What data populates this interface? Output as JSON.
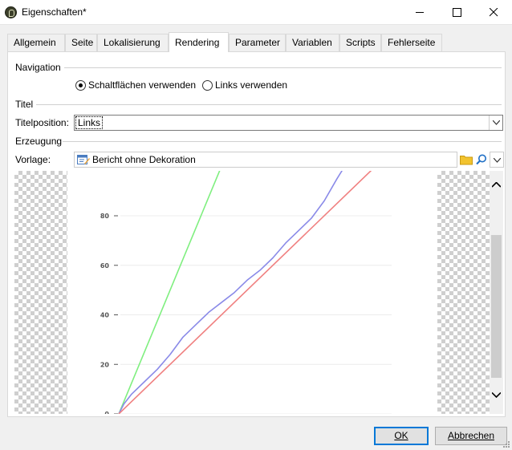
{
  "window": {
    "title": "Eigenschaften*"
  },
  "tabs": [
    {
      "label": "Allgemein"
    },
    {
      "label": "Seite"
    },
    {
      "label": "Lokalisierung"
    },
    {
      "label": "Rendering",
      "active": true
    },
    {
      "label": "Parameter"
    },
    {
      "label": "Variablen"
    },
    {
      "label": "Scripts"
    },
    {
      "label": "Fehlerseite"
    }
  ],
  "navigation": {
    "group_label": "Navigation",
    "option_buttons": "Schaltflächen verwenden",
    "option_links": "Links verwenden",
    "selected": "Schaltflächen verwenden"
  },
  "titel": {
    "group_label": "Titel",
    "position_label": "Titelposition:",
    "position_value": "Links"
  },
  "erzeugung": {
    "group_label": "Erzeugung",
    "vorlage_label": "Vorlage:",
    "vorlage_value": "Bericht ohne Dekoration"
  },
  "preview_chart": {
    "chart_data": {
      "type": "line",
      "title": "",
      "xlabel": "",
      "ylabel": "",
      "y_ticks": [
        0,
        20,
        40,
        60,
        80
      ],
      "ylim": [
        0,
        100
      ],
      "xlim": [
        0,
        100
      ],
      "grid": true,
      "series": [
        {
          "color": "#7fef7f",
          "x": [
            0,
            40
          ],
          "y": [
            0,
            100
          ]
        },
        {
          "color": "#8a8ae8",
          "x": [
            0,
            2,
            5,
            10,
            15,
            20,
            25,
            30,
            35,
            40,
            45,
            50,
            55,
            60,
            65,
            70,
            75,
            80,
            85,
            88
          ],
          "y": [
            0,
            4,
            8,
            13,
            18,
            24,
            31,
            36,
            41,
            45,
            49,
            54,
            58,
            63,
            69,
            74,
            79,
            86,
            95,
            100
          ]
        },
        {
          "color": "#f08080",
          "x": [
            0,
            100
          ],
          "y": [
            0,
            100
          ]
        }
      ]
    }
  },
  "buttons": {
    "ok": "OK",
    "cancel": "Abbrechen"
  },
  "colors": {
    "accent": "#0078d7",
    "window_bg": "#f0f0f0",
    "panel_bg": "#ffffff"
  },
  "icons": {
    "app": "app-icon",
    "minimize": "minimize-icon",
    "maximize": "maximize-icon",
    "close": "close-icon",
    "template": "template-icon",
    "folder": "folder-icon",
    "search": "search-icon",
    "dropdown": "chevron-down-icon"
  }
}
